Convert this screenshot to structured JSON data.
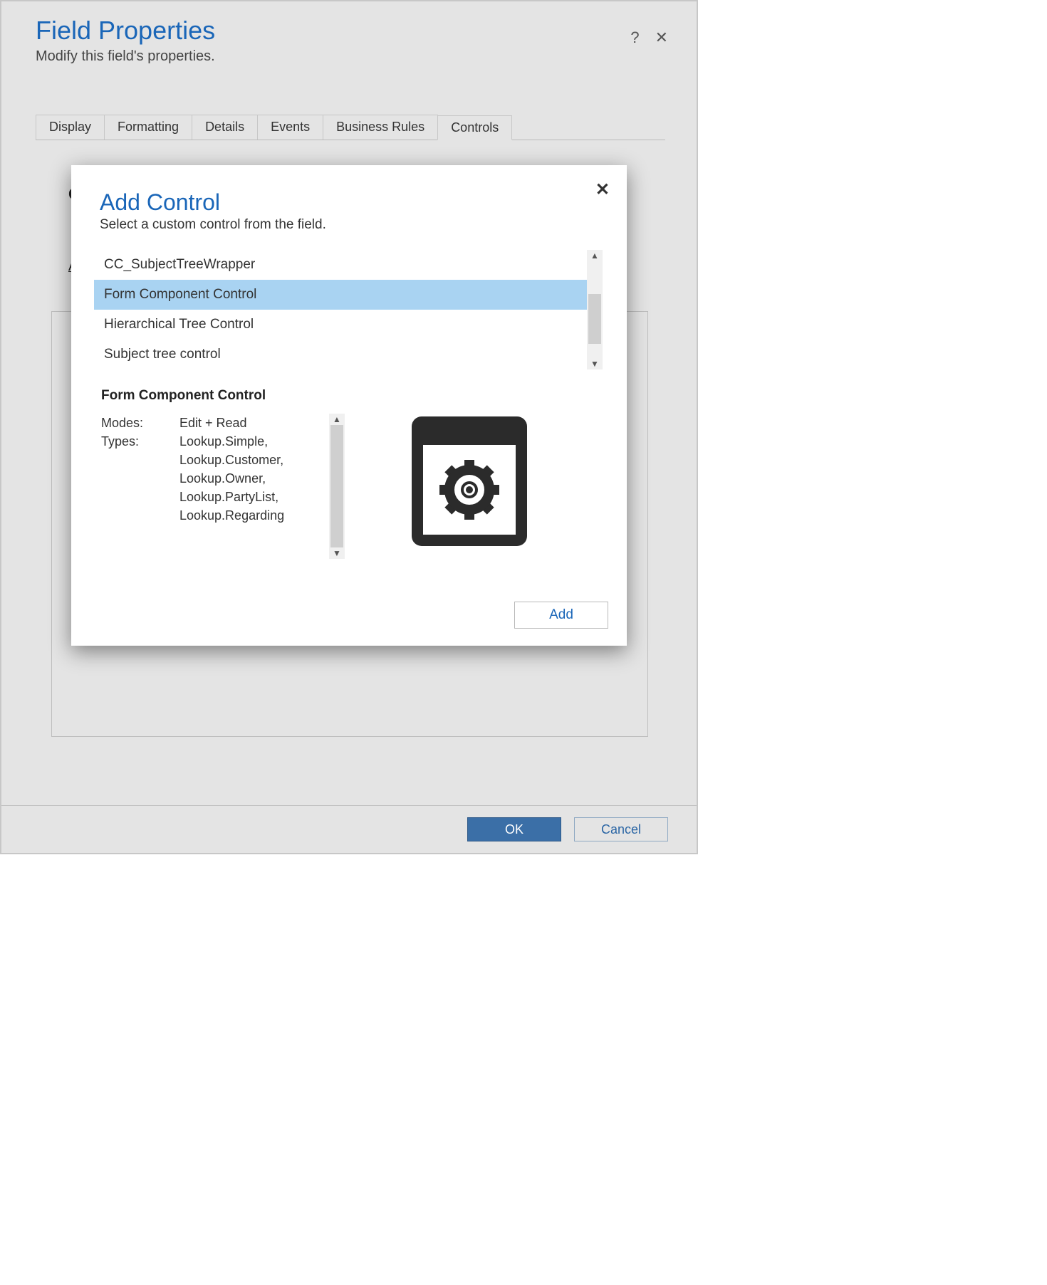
{
  "field_properties": {
    "title": "Field Properties",
    "subtitle": "Modify this field's properties.",
    "tabs": [
      "Display",
      "Formatting",
      "Details",
      "Events",
      "Business Rules",
      "Controls"
    ],
    "active_tab_index": 5,
    "peek_link_char": "A",
    "peek_c": "C",
    "buttons": {
      "ok": "OK",
      "cancel": "Cancel"
    }
  },
  "add_control": {
    "title": "Add Control",
    "subtitle": "Select a custom control from the field.",
    "items": [
      "CC_SubjectTreeWrapper",
      "Form Component Control",
      "Hierarchical Tree Control",
      "Subject tree control"
    ],
    "selected_index": 1,
    "selected_name": "Form Component Control",
    "detail": {
      "modes_label": "Modes:",
      "modes_value": "Edit + Read",
      "types_label": "Types:",
      "types_value": "Lookup.Simple, Lookup.Customer, Lookup.Owner, Lookup.PartyList, Lookup.Regarding"
    },
    "add_button": "Add"
  }
}
